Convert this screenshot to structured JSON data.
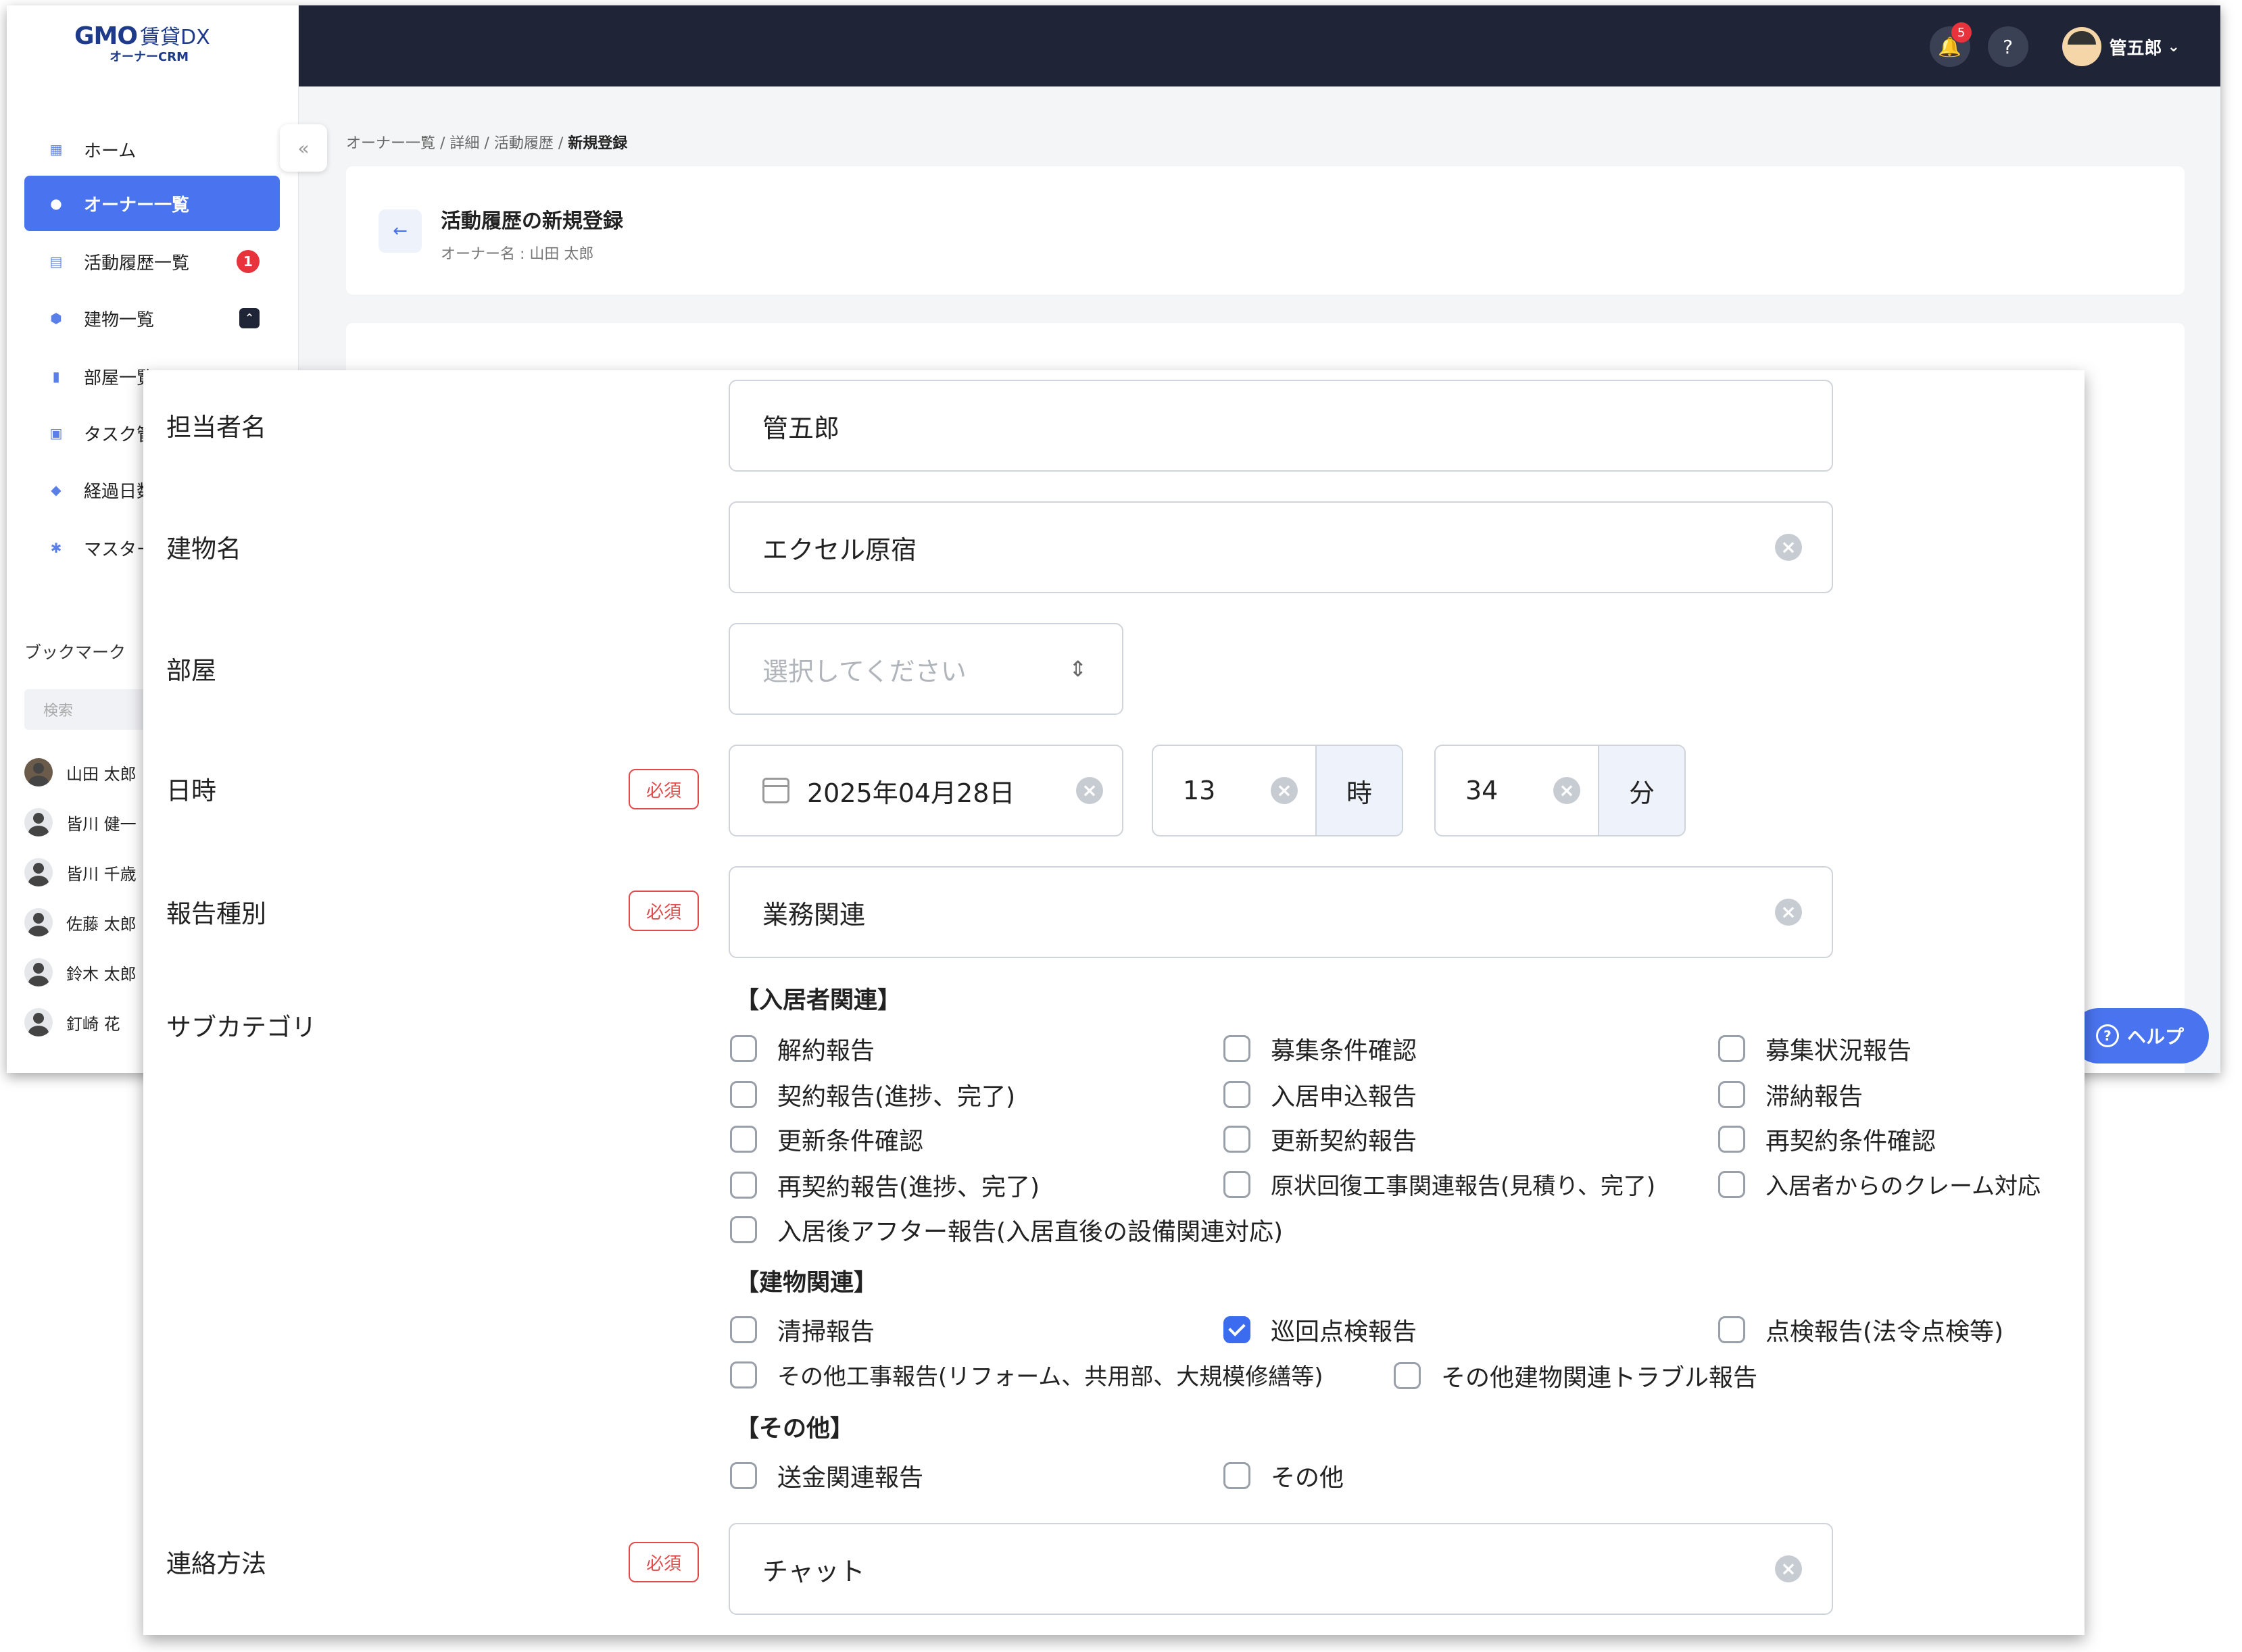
{
  "app": {
    "logo": {
      "brand": "GMO",
      "product": "賃貸DX",
      "sub": "オーナーCRM"
    },
    "header": {
      "notification_count": "5",
      "user_name": "管五郎"
    },
    "sidebar": {
      "items": [
        {
          "label": "ホーム"
        },
        {
          "label": "オーナー一覧"
        },
        {
          "label": "活動履歴一覧",
          "badge": "1"
        },
        {
          "label": "建物一覧"
        },
        {
          "label": "部屋一覧"
        },
        {
          "label": "タスク管"
        },
        {
          "label": "経過日数"
        },
        {
          "label": "マスター"
        }
      ],
      "bookmark_title": "ブックマーク",
      "search_placeholder": "検索",
      "bookmarks": [
        "山田 太郎",
        "皆川 健一",
        "皆川 千歳",
        "佐藤 太郎",
        "鈴木 太郎",
        "釘崎 花"
      ]
    },
    "breadcrumb": {
      "items": [
        "オーナー一覧",
        "詳細",
        "活動履歴"
      ],
      "current": "新規登録"
    },
    "page": {
      "title": "活動履歴の新規登録",
      "owner_label": "オーナー名 : 山田 太郎"
    },
    "help_label": "ヘルプ"
  },
  "form": {
    "required_label": "必須",
    "assignee": {
      "label": "担当者名",
      "value": "管五郎"
    },
    "building": {
      "label": "建物名",
      "value": "エクセル原宿"
    },
    "room": {
      "label": "部屋",
      "placeholder": "選択してください"
    },
    "datetime": {
      "label": "日時",
      "date": "2025年04月28日",
      "hour": "13",
      "hour_unit": "時",
      "minute": "34",
      "minute_unit": "分"
    },
    "report_type": {
      "label": "報告種別",
      "value": "業務関連"
    },
    "subcategory": {
      "label": "サブカテゴリ",
      "groups": [
        {
          "title": "【入居者関連】",
          "options": [
            {
              "label": "解約報告",
              "checked": false
            },
            {
              "label": "募集条件確認",
              "checked": false
            },
            {
              "label": "募集状況報告",
              "checked": false
            },
            {
              "label": "契約報告(進捗、完了)",
              "checked": false
            },
            {
              "label": "入居申込報告",
              "checked": false
            },
            {
              "label": "滞納報告",
              "checked": false
            },
            {
              "label": "更新条件確認",
              "checked": false
            },
            {
              "label": "更新契約報告",
              "checked": false
            },
            {
              "label": "再契約条件確認",
              "checked": false
            },
            {
              "label": "再契約報告(進捗、完了)",
              "checked": false
            },
            {
              "label": "原状回復工事関連報告(見積り、完了)",
              "checked": false
            },
            {
              "label": "入居者からのクレーム対応",
              "checked": false
            },
            {
              "label": "入居後アフター報告(入居直後の設備関連対応)",
              "checked": false
            }
          ]
        },
        {
          "title": "【建物関連】",
          "options": [
            {
              "label": "清掃報告",
              "checked": false
            },
            {
              "label": "巡回点検報告",
              "checked": true
            },
            {
              "label": "点検報告(法令点検等)",
              "checked": false
            },
            {
              "label": "その他工事報告(リフォーム、共用部、大規模修繕等)",
              "checked": false
            },
            {
              "label": "その他建物関連トラブル報告",
              "checked": false
            }
          ]
        },
        {
          "title": "【その他】",
          "options": [
            {
              "label": "送金関連報告",
              "checked": false
            },
            {
              "label": "その他",
              "checked": false
            }
          ]
        }
      ]
    },
    "contact_method": {
      "label": "連絡方法",
      "value": "チャット"
    }
  }
}
